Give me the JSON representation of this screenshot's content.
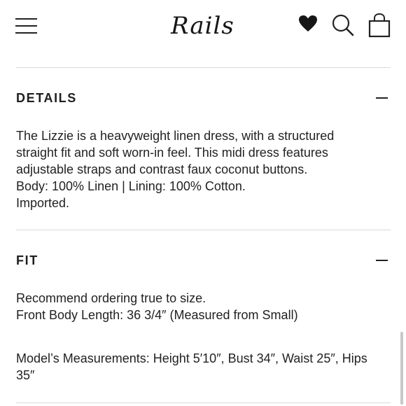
{
  "header": {
    "logo_text": "Rails",
    "icons": [
      "menu-icon",
      "heart-icon",
      "search-icon",
      "shopping-bag-icon"
    ]
  },
  "sections": [
    {
      "title": "DETAILS",
      "toggle": "collapse",
      "lines": [
        "The Lizzie is a heavyweight linen dress, with a structured",
        "straight fit and soft worn-in feel. This midi dress features",
        "adjustable straps and contrast faux coconut buttons.",
        "Body: 100% Linen | Lining: 100% Cotton.",
        "Imported."
      ]
    },
    {
      "title": "FIT",
      "toggle": "collapse",
      "lines": [
        "Recommend ordering true to size.",
        "Front Body Length: 36 3/4″ (Measured from Small)"
      ],
      "model_lines": [
        "Model’s Measurements: Height 5′10″, Bust 34″, Waist 25″, Hips",
        "35″"
      ]
    }
  ]
}
